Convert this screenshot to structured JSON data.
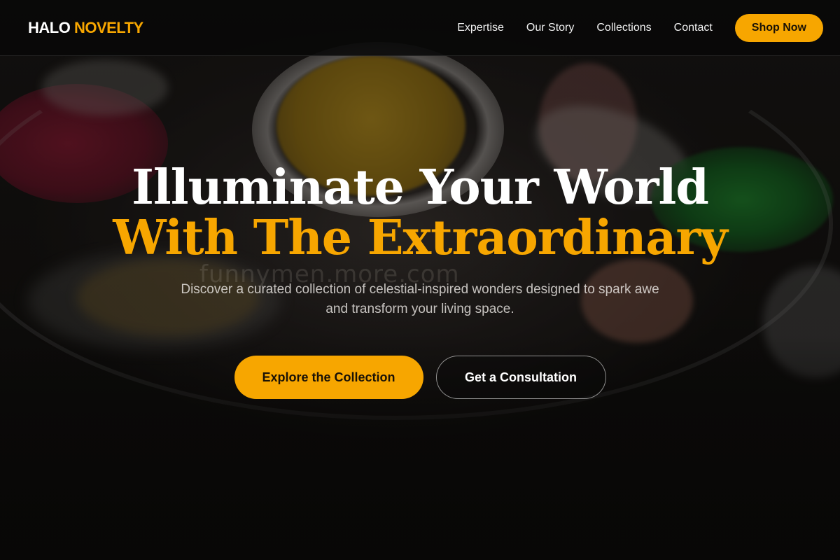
{
  "brand": {
    "word1": "HALO",
    "word2": "NOVELTY",
    "accent_color": "#f7a600"
  },
  "nav": {
    "links": [
      {
        "label": "Expertise"
      },
      {
        "label": "Our Story"
      },
      {
        "label": "Collections"
      },
      {
        "label": "Contact"
      }
    ],
    "cta_label": "Shop Now"
  },
  "hero": {
    "title_line1": "Illuminate Your World",
    "title_line2": "With The Extraordinary",
    "subtitle": "Discover a curated collection of celestial-inspired wonders designed to spark awe and transform your living space.",
    "primary_cta": "Explore the Collection",
    "secondary_cta": "Get a Consultation",
    "watermark": "funnymen.more.com"
  },
  "colors": {
    "accent": "#f7a600",
    "background": "#0a0908",
    "text": "#ffffff"
  }
}
